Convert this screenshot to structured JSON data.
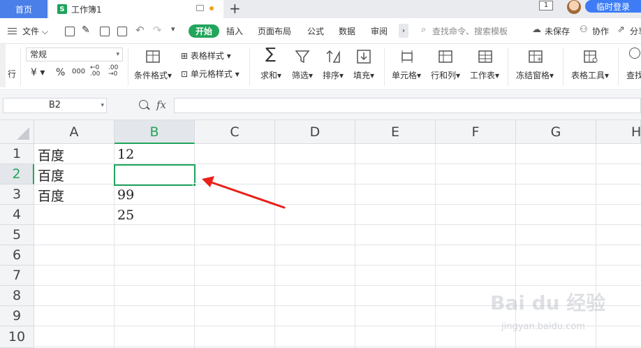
{
  "tabs": {
    "home_label": "首页",
    "doc_icon": "S",
    "doc_title": "工作簿1",
    "plus": "+",
    "window_badge": "1",
    "login_label": "临时登录"
  },
  "menu": {
    "file": "文件",
    "start": "开始",
    "items": [
      "插入",
      "页面布局",
      "公式",
      "数据",
      "审阅"
    ],
    "search_placeholder": "查找命令、搜索模板",
    "unsaved": "未保存",
    "collab": "协作",
    "share": "分享"
  },
  "ribbon": {
    "left_label": "行",
    "number_format": "常规",
    "currency_symbol": "¥",
    "percent_symbol": "%",
    "thousands": "000",
    "decimal_inc": "←0 .00",
    "decimal_dec": ".00 →0",
    "cond_format": "条件格式",
    "table_style": "表格样式",
    "cell_style": "单元格样式",
    "sum": "求和",
    "filter": "筛选",
    "sort": "排序",
    "fill": "填充",
    "cell": "单元格",
    "row_col": "行和列",
    "worksheet": "工作表",
    "freeze": "冻结窗格",
    "table_tools": "表格工具",
    "find": "查找"
  },
  "formula_bar": {
    "name_box": "B2",
    "fx_label": "fx",
    "formula": ""
  },
  "grid": {
    "columns": [
      "A",
      "B",
      "C",
      "D",
      "E",
      "F",
      "G",
      "H"
    ],
    "active_column": "B",
    "rows": [
      "1",
      "2",
      "3",
      "4",
      "5",
      "6",
      "7",
      "8",
      "9",
      "10"
    ],
    "active_row": "2",
    "cells": {
      "A1": "百度",
      "A2": "百度",
      "A3": "百度",
      "B1": "12",
      "B2": "",
      "B3": "99",
      "B4": "25"
    }
  },
  "annotation": {
    "arrow_color": "#e8221a"
  },
  "watermark": {
    "text": "Bai du 经验",
    "url": "jingyan.baidu.com"
  },
  "colors": {
    "accent_green": "#22a55c",
    "tab_blue": "#4a7ee8",
    "login_blue": "#3d7cf5"
  }
}
